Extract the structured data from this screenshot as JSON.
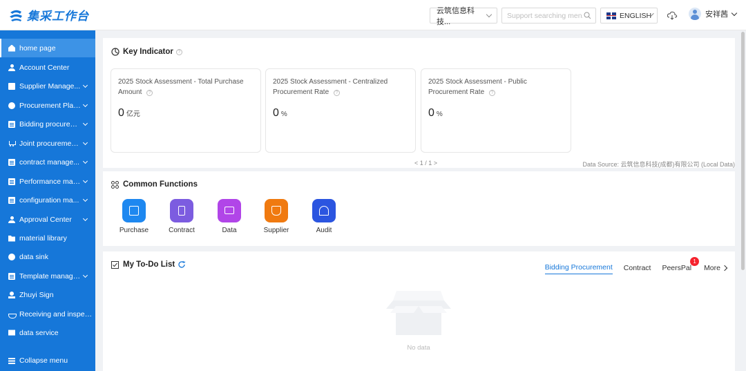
{
  "app": {
    "logo_text": "集采工作台"
  },
  "header": {
    "org_select": "云筑信息科技...",
    "search_placeholder": "Support searching men...",
    "language": "ENGLISH",
    "user_name": "安祥茜"
  },
  "sidebar": {
    "items": [
      {
        "label": "home page",
        "icon": "home-icon"
      },
      {
        "label": "Account Center",
        "icon": "user-icon"
      },
      {
        "label": "Supplier Manage...",
        "icon": "box-icon"
      },
      {
        "label": "Procurement Plan...",
        "icon": "circle-icon"
      },
      {
        "label": "Bidding procurem...",
        "icon": "doc-icon"
      },
      {
        "label": "Joint procuremen...",
        "icon": "cart-icon"
      },
      {
        "label": "contract manage...",
        "icon": "doc-icon"
      },
      {
        "label": "Performance man...",
        "icon": "doc-icon"
      },
      {
        "label": "configuration ma...",
        "icon": "doc-icon"
      },
      {
        "label": "Approval Center",
        "icon": "user-icon"
      },
      {
        "label": "material library",
        "icon": "folder-icon"
      },
      {
        "label": "data sink",
        "icon": "circle-icon"
      },
      {
        "label": "Template manage...",
        "icon": "doc-icon"
      },
      {
        "label": "Zhuyi Sign",
        "icon": "seal-icon"
      },
      {
        "label": "Receiving and inspectin...",
        "icon": "scale-icon"
      },
      {
        "label": "data service",
        "icon": "data-icon"
      }
    ],
    "collapse_label": "Collapse menu"
  },
  "key_indicator": {
    "title": "Key Indicator",
    "cards": [
      {
        "title": "2025 Stock Assessment - Total Purchase Amount",
        "value": "0",
        "unit": "亿元"
      },
      {
        "title": "2025 Stock Assessment - Centralized Procurement Rate",
        "value": "0",
        "unit": "%"
      },
      {
        "title": "2025 Stock Assessment - Public Procurement Rate",
        "value": "0",
        "unit": "%"
      }
    ],
    "pagination": "< 1 / 1 >",
    "data_source": "Data Source: 云筑信息科技(成都)有限公司 (Local Data)"
  },
  "common_functions": {
    "title": "Common Functions",
    "items": [
      {
        "label": "Purchase",
        "color": "#1e88f0"
      },
      {
        "label": "Contract",
        "color": "#7c5ce0"
      },
      {
        "label": "Data",
        "color": "#b145e8"
      },
      {
        "label": "Supplier",
        "color": "#f07a10"
      },
      {
        "label": "Audit",
        "color": "#2b55e0"
      }
    ]
  },
  "todo": {
    "title": "My To-Do List",
    "tabs": [
      {
        "label": "Bidding Procurement",
        "active": true
      },
      {
        "label": "Contract",
        "active": false
      },
      {
        "label": "PeersPal",
        "active": false,
        "badge": "1"
      }
    ],
    "more_label": "More",
    "empty_text": "No data"
  }
}
